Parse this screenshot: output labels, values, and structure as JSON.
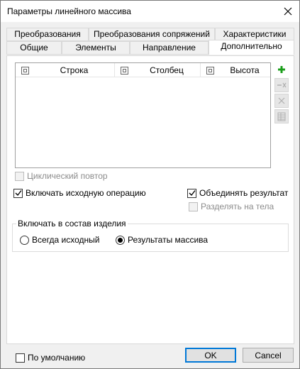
{
  "window": {
    "title": "Параметры линейного массива"
  },
  "tabs": {
    "row_back": [
      "Преобразования",
      "Преобразования сопряжений",
      "Характеристики"
    ],
    "row_front": [
      "Общие",
      "Элементы",
      "Направление",
      "Дополнительно"
    ],
    "active": "Дополнительно"
  },
  "table": {
    "columns": [
      "Строка",
      "Столбец",
      "Высота"
    ],
    "rows": []
  },
  "side_buttons": [
    {
      "icon": "add-icon",
      "enabled": true
    },
    {
      "icon": "remove-icon",
      "enabled": false
    },
    {
      "icon": "delete-icon",
      "enabled": false
    },
    {
      "icon": "table-icon",
      "enabled": false
    }
  ],
  "options": {
    "cyclic_repeat": {
      "label": "Циклический повтор",
      "checked": false,
      "enabled": false
    },
    "include_source": {
      "label": "Включать исходную операцию",
      "checked": true,
      "enabled": true
    },
    "merge_result": {
      "label": "Объединять результат",
      "checked": true,
      "enabled": true
    },
    "split_bodies": {
      "label": "Разделять на тела",
      "checked": false,
      "enabled": false
    }
  },
  "include_group": {
    "title": "Включать в состав изделия",
    "options": [
      "Всегда исходный",
      "Результаты массива"
    ],
    "selected": "Результаты массива"
  },
  "footer": {
    "default_label": "По умолчанию",
    "default_checked": false,
    "ok_label": "OK",
    "cancel_label": "Cancel"
  },
  "colors": {
    "accent": "#0078d7",
    "add_green": "#1b9e1b"
  }
}
